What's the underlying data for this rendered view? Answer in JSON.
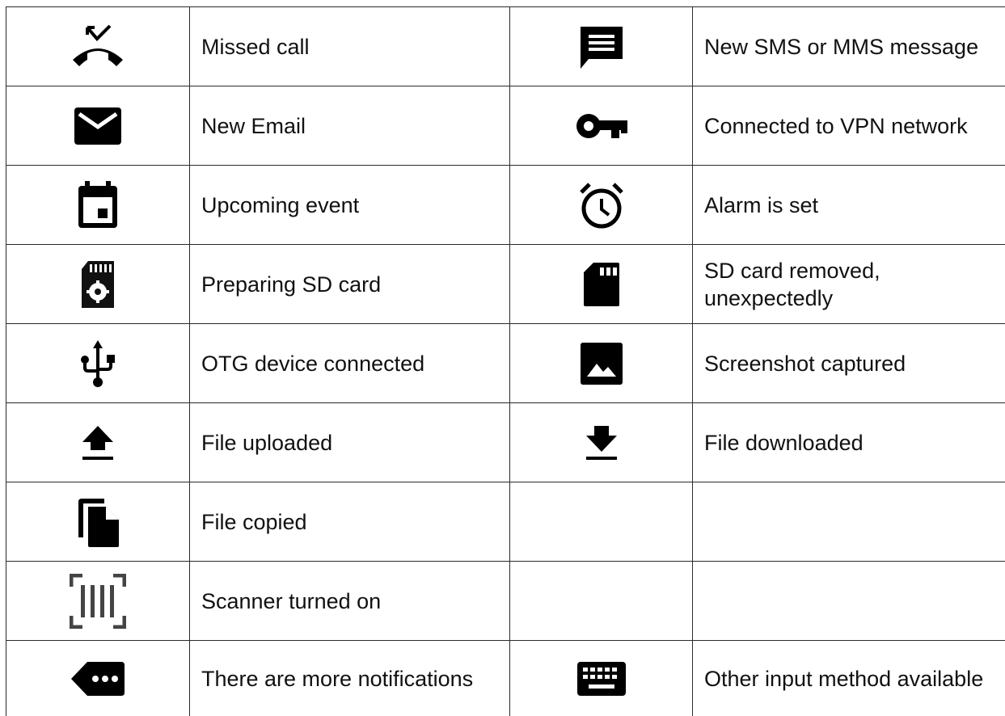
{
  "rows": [
    {
      "left": {
        "icon": "missed-call-icon",
        "label": "Missed call"
      },
      "right": {
        "icon": "sms-message-icon",
        "label": "New SMS or MMS message"
      }
    },
    {
      "left": {
        "icon": "email-icon",
        "label": "New Email"
      },
      "right": {
        "icon": "vpn-key-icon",
        "label": "Connected to VPN network"
      }
    },
    {
      "left": {
        "icon": "calendar-event-icon",
        "label": "Upcoming event"
      },
      "right": {
        "icon": "alarm-clock-icon",
        "label": "Alarm is set"
      }
    },
    {
      "left": {
        "icon": "sd-card-settings-icon",
        "label": "Preparing SD card"
      },
      "right": {
        "icon": "sd-card-icon",
        "label": "SD card removed, unexpectedly"
      }
    },
    {
      "left": {
        "icon": "usb-icon",
        "label": "OTG device connected"
      },
      "right": {
        "icon": "image-icon",
        "label": "Screenshot captured"
      }
    },
    {
      "left": {
        "icon": "upload-icon",
        "label": "File uploaded"
      },
      "right": {
        "icon": "download-icon",
        "label": "File downloaded"
      }
    },
    {
      "left": {
        "icon": "file-copy-icon",
        "label": "File copied"
      },
      "right": null
    },
    {
      "left": {
        "icon": "barcode-scanner-icon",
        "label": "Scanner turned on"
      },
      "right": null
    },
    {
      "left": {
        "icon": "more-notifications-icon",
        "label": "There are more notifications"
      },
      "right": {
        "icon": "keyboard-icon",
        "label": "Other input method available"
      }
    }
  ]
}
